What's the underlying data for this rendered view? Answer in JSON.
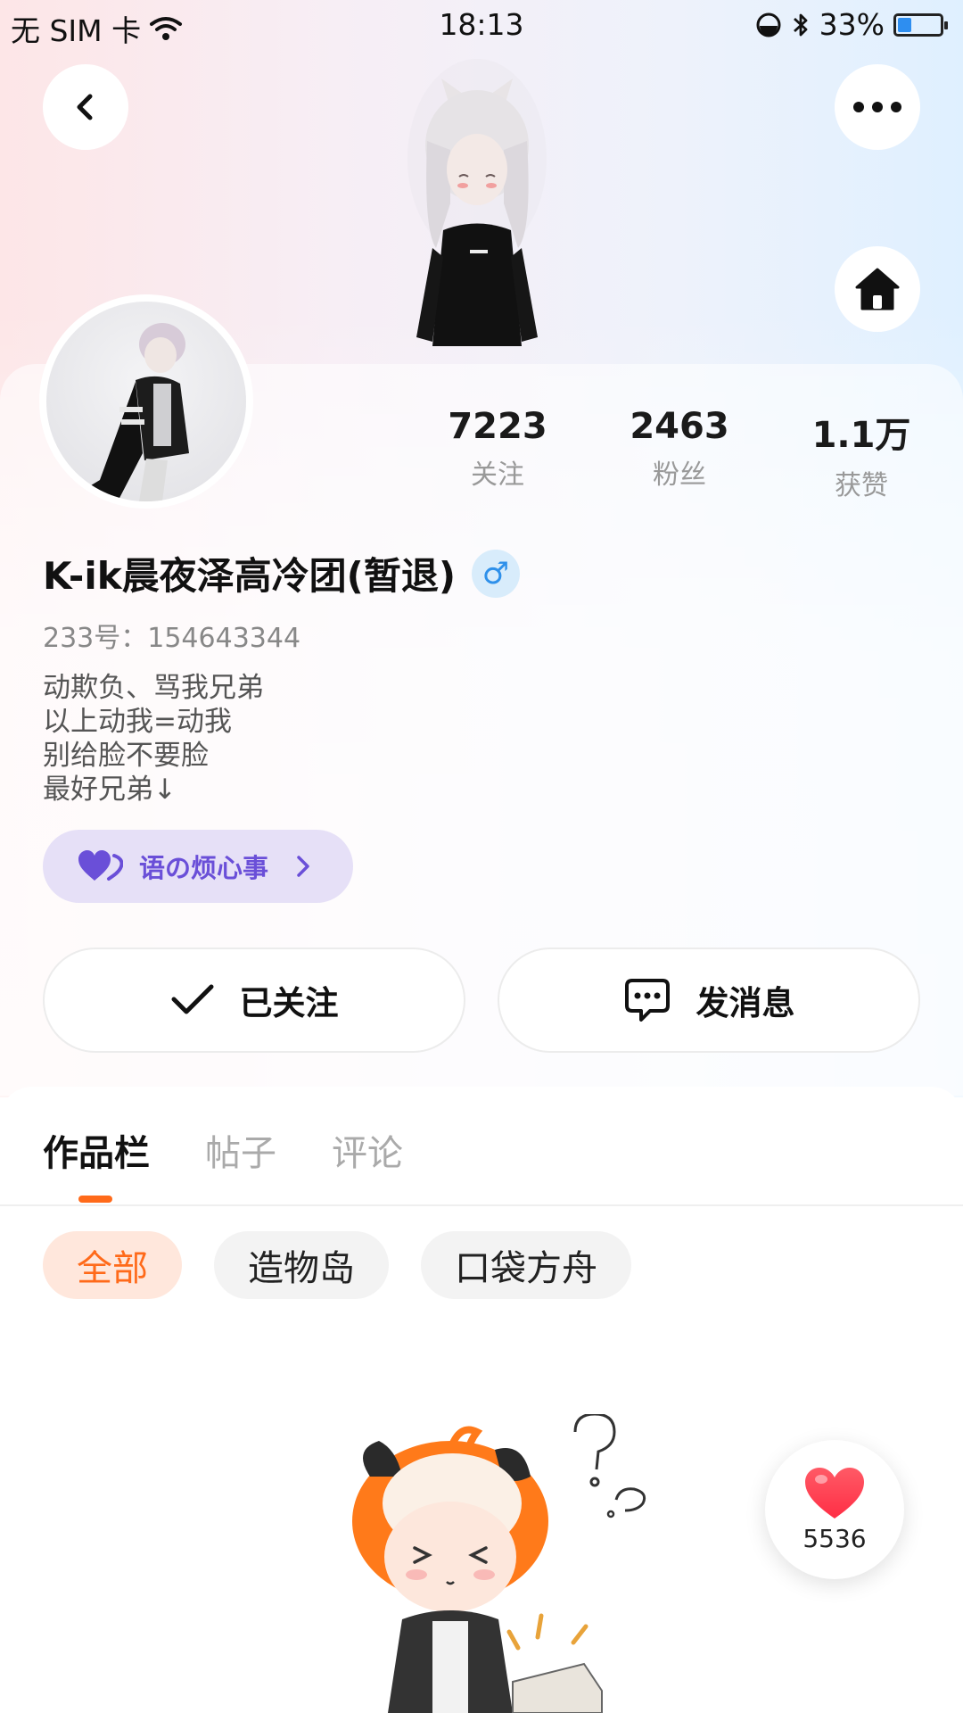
{
  "status_bar": {
    "carrier": "无 SIM 卡",
    "time": "18:13",
    "battery": "33%",
    "battery_level": 0.33
  },
  "header": {
    "back_icon": "chevron-left-icon",
    "more_icon": "more-horizontal-icon",
    "home_icon": "home-icon"
  },
  "profile": {
    "name": "K-ik晨夜泽高冷团(暂退)",
    "gender_symbol": "♂",
    "uid": "233号：154643344",
    "bio_lines": [
      "动欺负、骂我兄弟",
      "以上动我=动我",
      "别给脸不要脸",
      "最好兄弟↓"
    ]
  },
  "stats": [
    {
      "value": "7223",
      "label": "关注"
    },
    {
      "value": "2463",
      "label": "粉丝"
    },
    {
      "value": "1.1万",
      "label": "获赞"
    }
  ],
  "signature_badge": {
    "label": "语の烦心事"
  },
  "actions": {
    "follow_label": "已关注",
    "message_label": "发消息"
  },
  "tabs": [
    {
      "label": "作品栏",
      "active": true
    },
    {
      "label": "帖子",
      "active": false
    },
    {
      "label": "评论",
      "active": false
    }
  ],
  "filters": [
    {
      "label": "全部",
      "active": true
    },
    {
      "label": "造物岛",
      "active": false
    },
    {
      "label": "口袋方舟",
      "active": false
    }
  ],
  "like_fab": {
    "count": "5536"
  },
  "colors": {
    "accent": "#ff6a1a",
    "badge_purple": "#6a4fd8",
    "gender_blue": "#2e90ea",
    "heart_red": "#ff3b4a"
  }
}
